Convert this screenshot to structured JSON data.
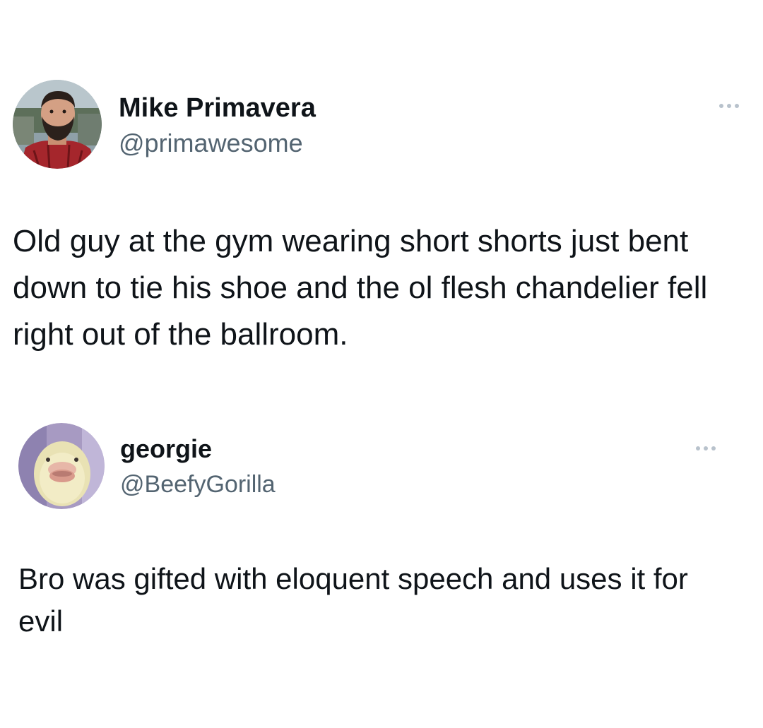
{
  "tweets": [
    {
      "author": {
        "display_name": "Mike Primavera",
        "handle": "@primawesome",
        "avatar_icon": "person-photo-avatar"
      },
      "more_icon": "more-options-icon",
      "text": "Old guy at the gym wearing short shorts just bent down to tie his shoe and the ol flesh chandelier fell right out of the ballroom."
    },
    {
      "author": {
        "display_name": "georgie",
        "handle": "@BeefyGorilla",
        "avatar_icon": "duck-photo-avatar"
      },
      "more_icon": "more-options-icon",
      "text": "Bro was gifted with eloquent speech and uses it for evil"
    }
  ],
  "colors": {
    "background": "#ffffff",
    "text_primary": "#0f1419",
    "text_secondary": "#536471",
    "icon_muted": "#b8c2cc"
  }
}
